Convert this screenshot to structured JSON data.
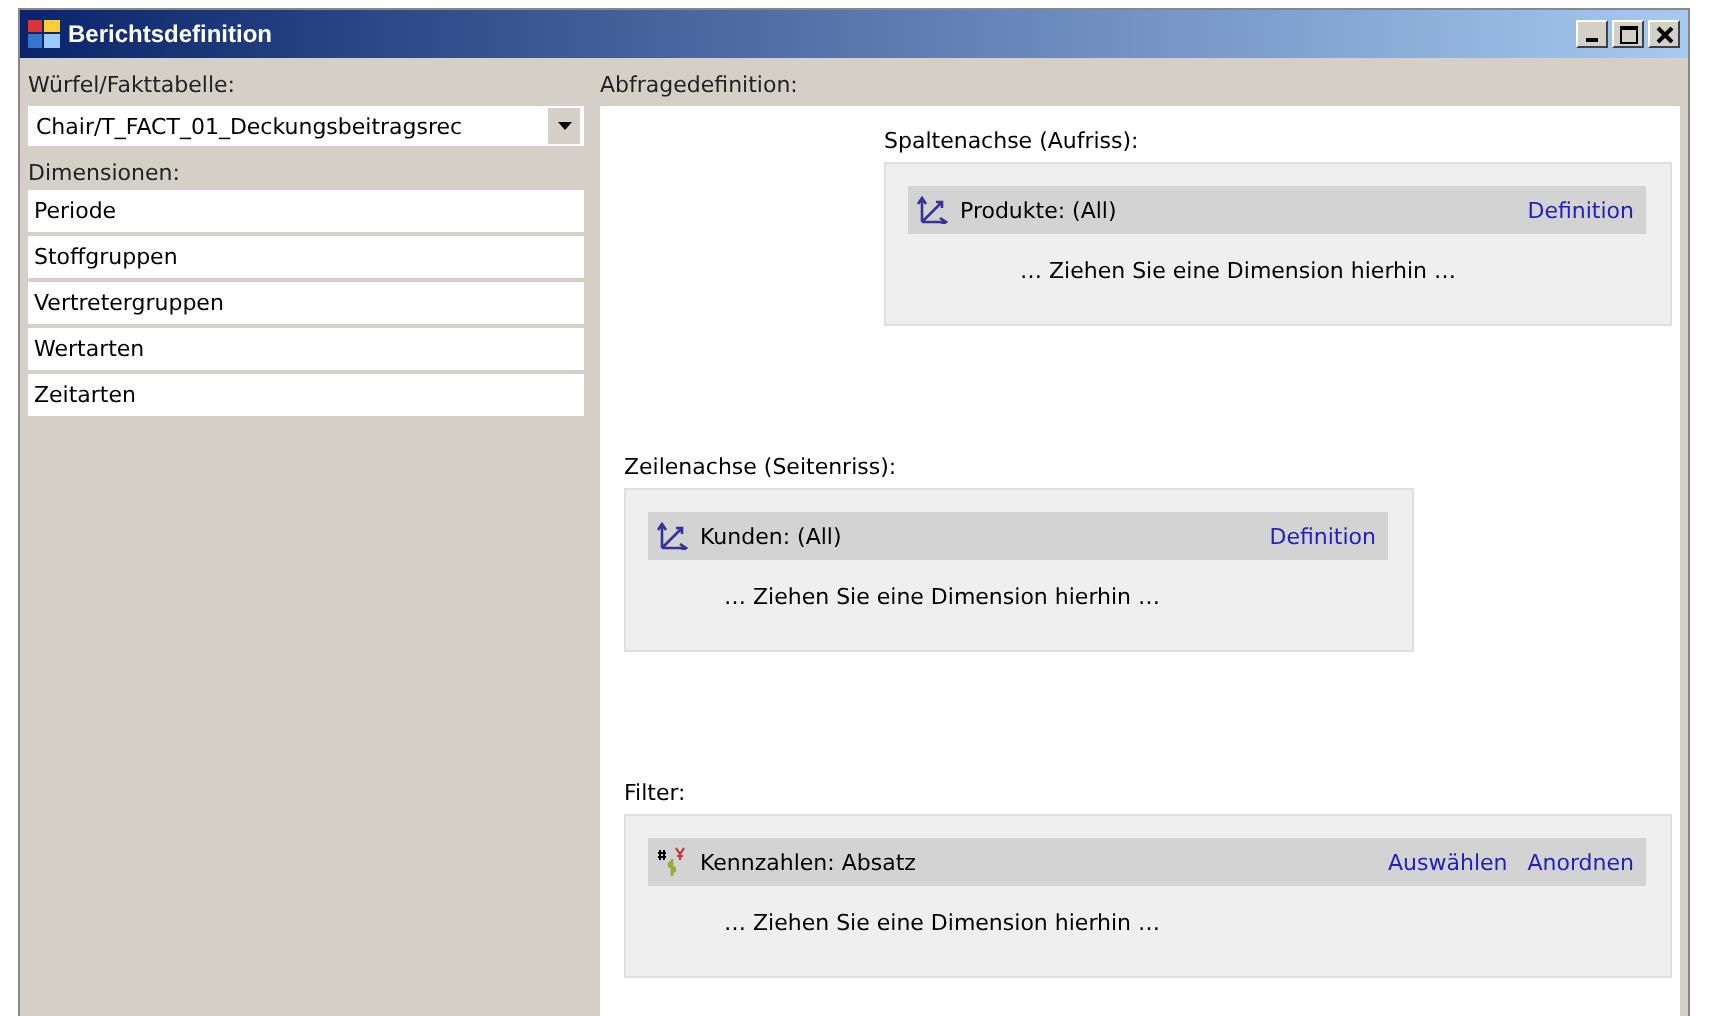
{
  "window": {
    "title": "Berichtsdefinition"
  },
  "cube": {
    "label": "Würfel/Fakttabelle:",
    "value": "Chair/T_FACT_01_Deckungsbeitragsrec"
  },
  "dimensions": {
    "label": "Dimensionen:",
    "items": [
      "Periode",
      "Stoffgruppen",
      "Vertretergruppen",
      "Wertarten",
      "Zeitarten"
    ]
  },
  "query": {
    "label": "Abfragedefinition:",
    "zones": [
      {
        "label": "Spaltenachse (Aufriss):",
        "item": {
          "kind": "axis",
          "text": "Produkte: (All)",
          "links": [
            "Definition"
          ]
        },
        "hint": "… Ziehen Sie eine Dimension hierhin …"
      },
      {
        "label": "Zeilenachse (Seitenriss):",
        "item": {
          "kind": "axis",
          "text": "Kunden: (All)",
          "links": [
            "Definition"
          ]
        },
        "hint": "… Ziehen Sie eine Dimension hierhin …"
      },
      {
        "label": "Filter:",
        "item": {
          "kind": "measures",
          "text": "Kennzahlen: Absatz",
          "links": [
            "Auswählen",
            "Anordnen"
          ]
        },
        "hint": "… Ziehen Sie eine Dimension hierhin …"
      }
    ]
  }
}
